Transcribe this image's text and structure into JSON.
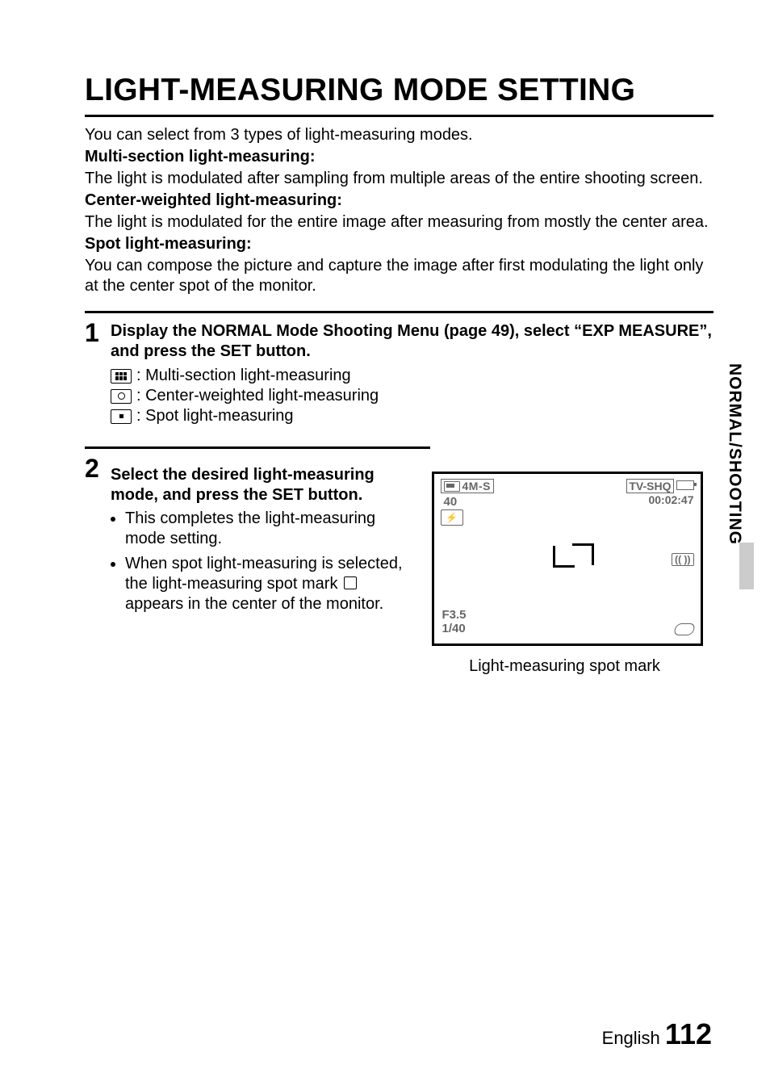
{
  "title": "LIGHT-MEASURING MODE SETTING",
  "intro": {
    "lead": "You can select from 3 types of light-measuring modes.",
    "m1_h": "Multi-section light-measuring:",
    "m1_t": "The light is modulated after sampling from multiple areas of the entire shooting screen.",
    "m2_h": "Center-weighted light-measuring:",
    "m2_t": "The light is modulated for the entire image after measuring from mostly the center area.",
    "m3_h": "Spot light-measuring:",
    "m3_t": "You can compose the picture and capture the image after first modulating the light only at the center spot of the monitor."
  },
  "step1": {
    "num": "1",
    "title": "Display the NORMAL Mode Shooting Menu (page 49), select “EXP MEASURE”, and press the SET button.",
    "i1": ": Multi-section light-measuring",
    "i2": ": Center-weighted light-measuring",
    "i3": ": Spot light-measuring"
  },
  "step2": {
    "num": "2",
    "title": "Select the desired light-measuring mode, and press the SET button.",
    "b1": "This completes the light-measuring mode setting.",
    "b2a": "When spot light-measuring is selected, the light-measuring spot mark ",
    "b2b": " appears in the center of the monitor."
  },
  "lcd": {
    "mode": "4M-S",
    "remaining": "40",
    "quality": "TV-SHQ",
    "time": "00:02:47",
    "mic": "(( ))",
    "aperture": "F3.5",
    "shutter": "1/40"
  },
  "caption": "Light-measuring spot mark",
  "sidetab": "NORMAL/SHOOTING",
  "footer_lang": "English",
  "footer_page": "112"
}
